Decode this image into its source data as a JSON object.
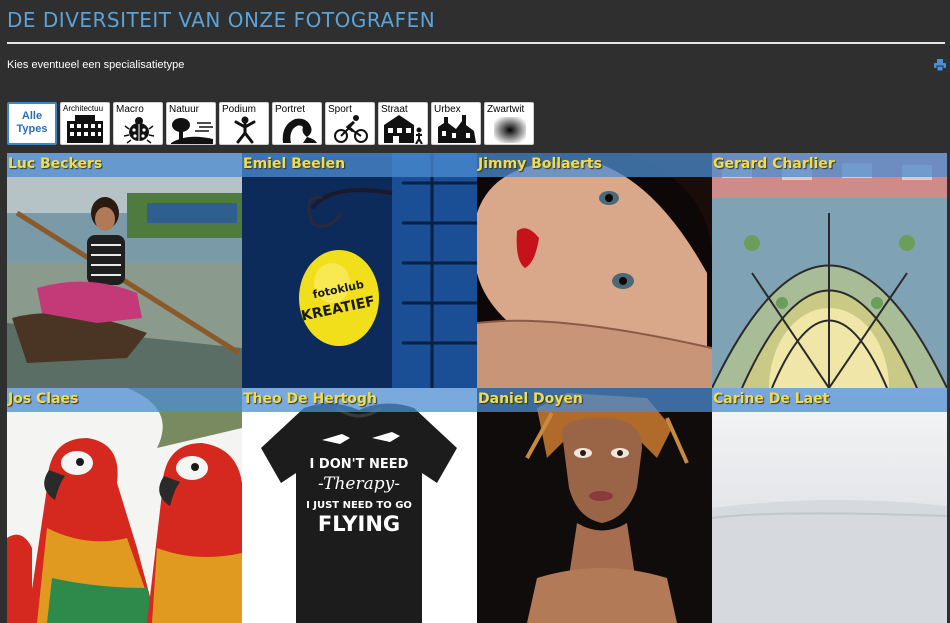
{
  "page": {
    "title": "DE DIVERSITEIT VAN ONZE FOTOGRAFEN",
    "subtitle": "Kies eventueel een specialisatietype",
    "print_icon": "printer-icon"
  },
  "filters": [
    {
      "label": "Alle Types",
      "icon": "none",
      "active": true
    },
    {
      "label": "Architectuu",
      "icon": "building-icon"
    },
    {
      "label": "Macro",
      "icon": "ladybug-icon"
    },
    {
      "label": "Natuur",
      "icon": "tree-icon"
    },
    {
      "label": "Podium",
      "icon": "dancer-icon"
    },
    {
      "label": "Portret",
      "icon": "portrait-icon"
    },
    {
      "label": "Sport",
      "icon": "cyclist-icon"
    },
    {
      "label": "Straat",
      "icon": "street-icon"
    },
    {
      "label": "Urbex",
      "icon": "ruin-icon"
    },
    {
      "label": "Zwartwit",
      "icon": "gradient-icon"
    }
  ],
  "photographers": [
    {
      "name": "Luc Beckers"
    },
    {
      "name": "Emiel Beelen"
    },
    {
      "name": "Jimmy Bollaerts"
    },
    {
      "name": "Gerard Charlier"
    },
    {
      "name": "Jos Claes"
    },
    {
      "name": "Theo De Hertogh"
    },
    {
      "name": "Daniel Doyen"
    },
    {
      "name": "Carine De Laet"
    }
  ],
  "photo_text": {
    "sign_line1": "fotoklub",
    "sign_line2": "KREATIEF",
    "shirt_line1": "I DON'T NEED",
    "shirt_line2": "-Therapy-",
    "shirt_line3": "I JUST NEED TO GO",
    "shirt_line4": "FLYING"
  },
  "colors": {
    "background": "#2f2f2f",
    "title": "#5aa2d8",
    "name_text": "#f0dd4a",
    "name_bar": "#4c8cd2"
  }
}
